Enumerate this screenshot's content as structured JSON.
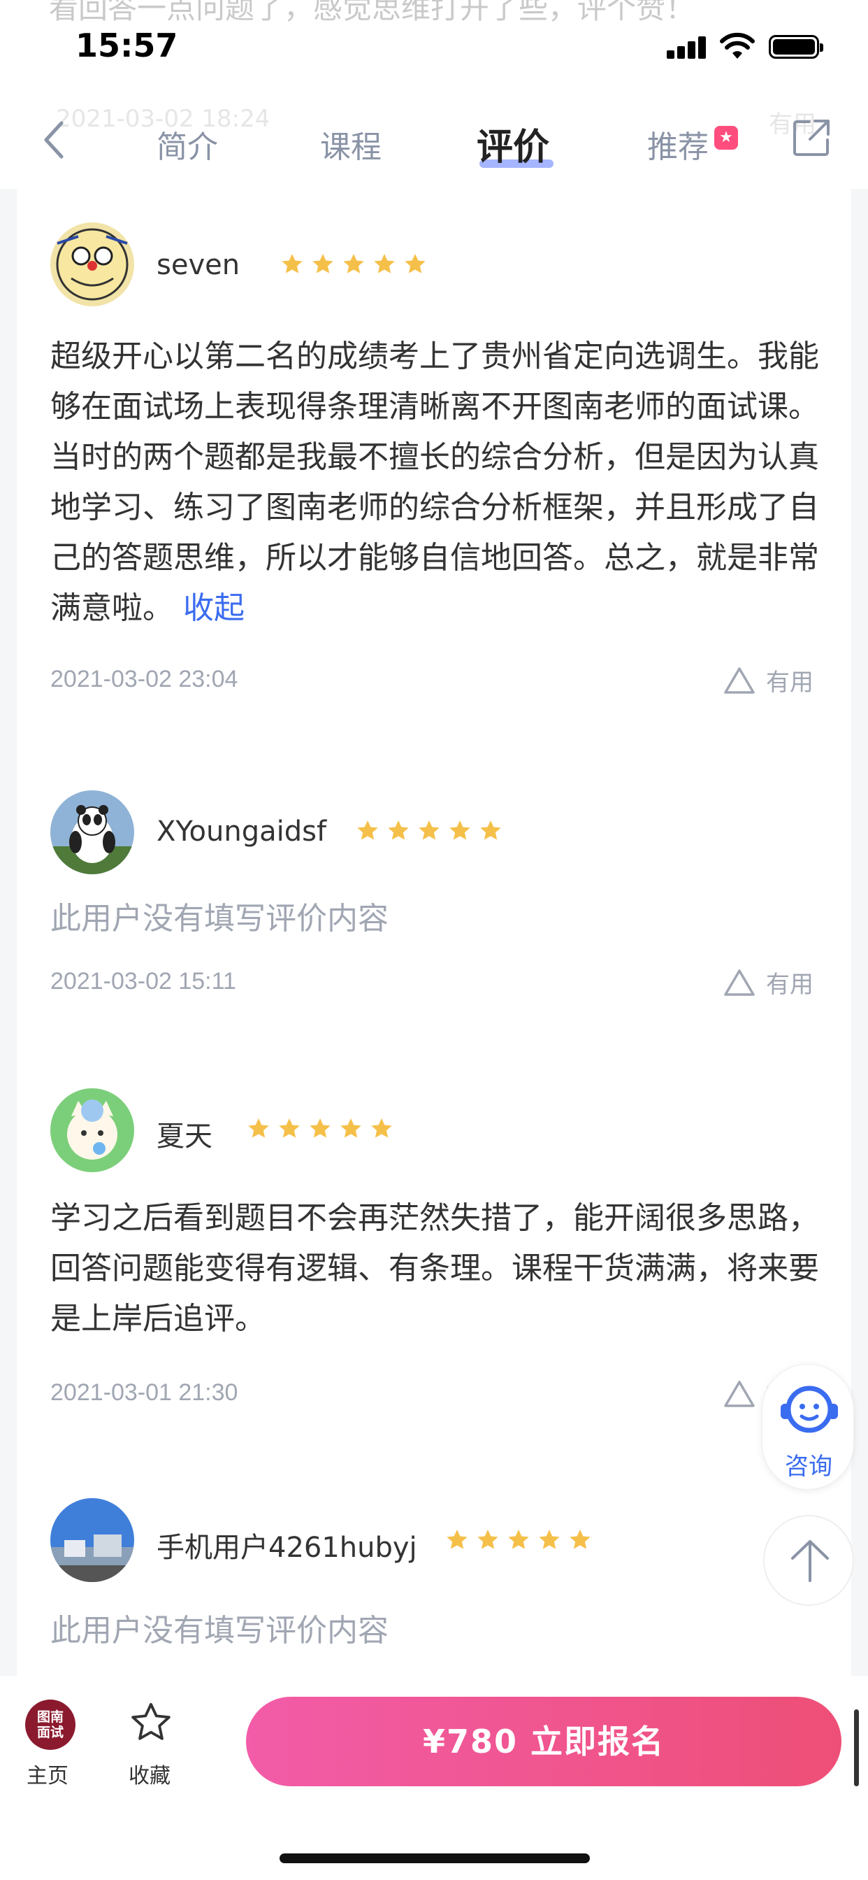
{
  "status_bar": {
    "time": "15:57",
    "ghost_text": "看回答一点问题了，感觉思维打开了些，评个赞！"
  },
  "nav": {
    "ghost_date": "2021-03-02 18:24",
    "ghost_useful": "有用",
    "tabs": [
      "简介",
      "课程",
      "评价",
      "推荐"
    ],
    "active_tab": "评价",
    "recommend_badge": "★"
  },
  "reviews": [
    {
      "username": "seven",
      "rating": 5,
      "text": "超级开心以第二名的成绩考上了贵州省定向选调生。我能够在面试场上表现得条理清晰离不开图南老师的面试课。当时的两个题都是我最不擅长的综合分析，但是因为认真地学习、练习了图南老师的综合分析框架，并且形成了自己的答题思维，所以才能够自信地回答。总之，就是非常满意啦。",
      "collapse_label": "收起",
      "date": "2021-03-02 23:04",
      "useful_label": "有用"
    },
    {
      "username": "XYoungaidsf",
      "rating": 5,
      "text": "此用户没有填写评价内容",
      "date": "2021-03-02 15:11",
      "useful_label": "有用"
    },
    {
      "username": "夏天",
      "rating": 5,
      "text": "学习之后看到题目不会再茫然失措了，能开阔很多思路，回答问题能变得有逻辑、有条理。课程干货满满，将来要是上岸后追评。",
      "date": "2021-03-01 21:30",
      "useful_label": "有用"
    },
    {
      "username": "手机用户4261hubyj",
      "rating": 5,
      "text": "此用户没有填写评价内容"
    }
  ],
  "floating": {
    "consult_label": "咨询"
  },
  "bottom_bar": {
    "logo_text": "图南面试",
    "home_label": "主页",
    "favorite_label": "收藏",
    "signup_label": "¥780 立即报名"
  },
  "colors": {
    "accent": "#3a6cf0",
    "star": "#f5c04a",
    "cta_start": "#f25ca8",
    "cta_end": "#ee4f77"
  }
}
